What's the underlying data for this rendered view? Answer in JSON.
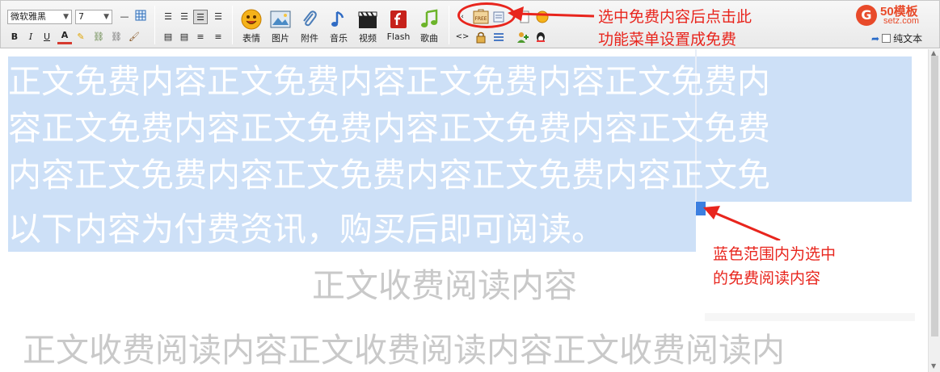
{
  "toolbar": {
    "font_family": "微软雅黑",
    "font_size": "7",
    "buttons": {
      "bold": "B",
      "italic": "I",
      "underline": "U"
    },
    "big_buttons": [
      {
        "label": "表情",
        "icon": "smiley-icon"
      },
      {
        "label": "图片",
        "icon": "image-icon"
      },
      {
        "label": "附件",
        "icon": "paperclip-icon"
      },
      {
        "label": "音乐",
        "icon": "music-note-icon"
      },
      {
        "label": "视频",
        "icon": "clapperboard-icon"
      },
      {
        "label": "Flash",
        "icon": "flash-icon"
      },
      {
        "label": "歌曲",
        "icon": "song-icon"
      }
    ],
    "free_badge": "FREE",
    "plain_text_label": "纯文本"
  },
  "brand": {
    "name": "50模板",
    "site": "setz.com"
  },
  "editor": {
    "free_lines": [
      "正文免费内容正文免费内容正文免费内容正文免费内",
      "容正文免费内容正文免费内容正文免费内容正文免费",
      "内容正文免费内容正文免费内容正文免费内容正文免",
      "以下内容为付费资讯，购买后即可阅读。"
    ],
    "paid_title": "正文收费阅读内容",
    "paid_body": "正文收费阅读内容正文收费阅读内容正文收费阅读内"
  },
  "annotations": {
    "top": [
      "选中免费内容后点击此",
      "功能菜单设置成免费"
    ],
    "side": [
      "蓝色范围内为选中",
      "的免费阅读内容"
    ]
  },
  "colors": {
    "annotation_red": "#e8251d",
    "selection_blue": "#cde0f7",
    "caret_blue": "#3c7fe0",
    "brand_orange": "#e84a2a"
  }
}
